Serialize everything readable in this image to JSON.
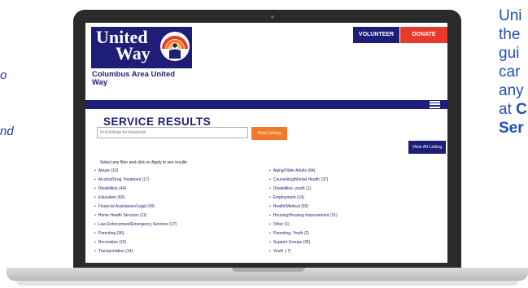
{
  "side_text": {
    "left_line1": "o",
    "left_line2": "nd",
    "right_lines": [
      "Uni",
      "the",
      "gui",
      "car",
      "any"
    ],
    "right_at": "at",
    "right_bold1": "C",
    "right_bold2": "Ser"
  },
  "logo": {
    "line1": "United",
    "line2": "Way",
    "org_name": "Columbus Area United Way"
  },
  "header": {
    "volunteer_label": "VOLUNTEER",
    "donate_label": "DONATE"
  },
  "page": {
    "title": "SERVICE RESULTS",
    "search_placeholder": "Find listings for keywords",
    "find_button": "Find Listing",
    "view_all_button": "View All Listing",
    "instruction": "Select any filter and click on Apply to see results"
  },
  "categories_left": [
    "Abuse (10)",
    "Alcohol/Drug Treatment (17)",
    "Disabilities (44)",
    "Education (69)",
    "Financial Assistance/Legal (49)",
    "Home Health Services (11)",
    "Law Enforcement/Emergency Services (17)",
    "Parenting (36)",
    "Recreation (15)",
    "Transportation (14)"
  ],
  "categories_right": [
    "Aging/Older Adults (64)",
    "Counseling/Mental Health (37)",
    "Disabilities; youth (1)",
    "Employment (14)",
    "Health/Medical (65)",
    "Housing/Housing Improvement (31)",
    "Other (1)",
    "Parenting; Youth (2)",
    "Support Groups (35)",
    "Youth (-7)"
  ],
  "colors": {
    "navy": "#1e1e78",
    "donate_red": "#e8392a",
    "find_orange": "#f2792a",
    "side_text_blue": "#1f4fb8"
  }
}
